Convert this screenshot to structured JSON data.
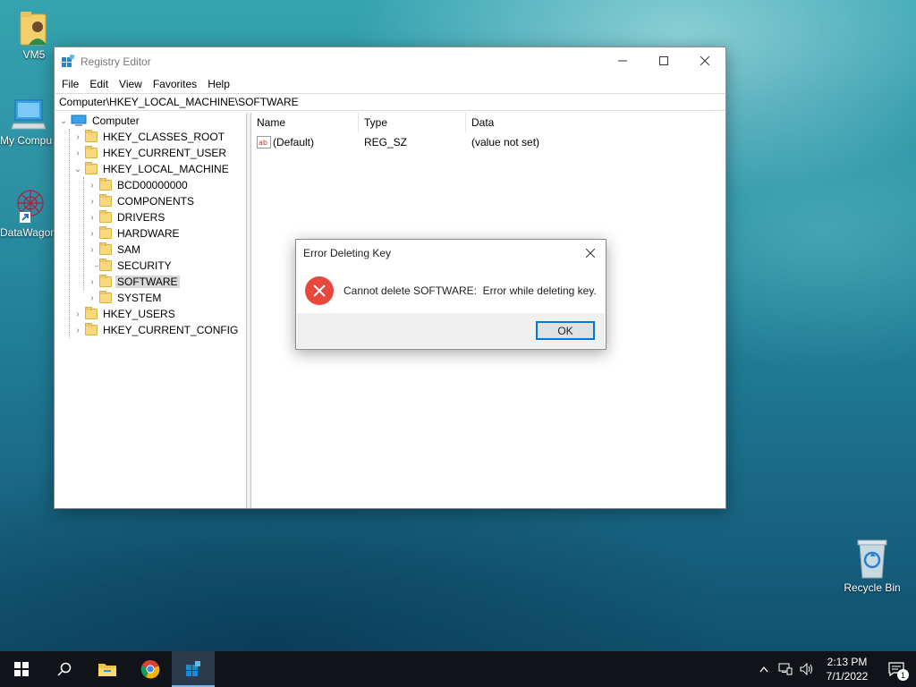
{
  "desktop": {
    "icons": [
      {
        "label": "VM5"
      },
      {
        "label": "My Compu"
      },
      {
        "label": "DataWagon"
      },
      {
        "label": "Recycle Bin"
      }
    ]
  },
  "window": {
    "title": "Registry Editor",
    "menu": [
      "File",
      "Edit",
      "View",
      "Favorites",
      "Help"
    ],
    "address": "Computer\\HKEY_LOCAL_MACHINE\\SOFTWARE",
    "tree": {
      "root": "Computer",
      "hives": [
        "HKEY_CLASSES_ROOT",
        "HKEY_CURRENT_USER",
        "HKEY_LOCAL_MACHINE",
        "HKEY_USERS",
        "HKEY_CURRENT_CONFIG"
      ],
      "hklm_children": [
        "BCD00000000",
        "COMPONENTS",
        "DRIVERS",
        "HARDWARE",
        "SAM",
        "SECURITY",
        "SOFTWARE",
        "SYSTEM"
      ],
      "selected": "SOFTWARE"
    },
    "columns": [
      "Name",
      "Type",
      "Data"
    ],
    "values": [
      {
        "name": "(Default)",
        "type": "REG_SZ",
        "data": "(value not set)"
      }
    ]
  },
  "dialog": {
    "title": "Error Deleting Key",
    "message": "Cannot delete SOFTWARE:  Error while deleting key.",
    "ok_label": "OK"
  },
  "taskbar": {
    "time": "2:13 PM",
    "date": "7/1/2022",
    "notification_count": "1"
  },
  "colors": {
    "accent": "#0078d7",
    "error": "#e8473e",
    "taskbar": "#101418"
  }
}
